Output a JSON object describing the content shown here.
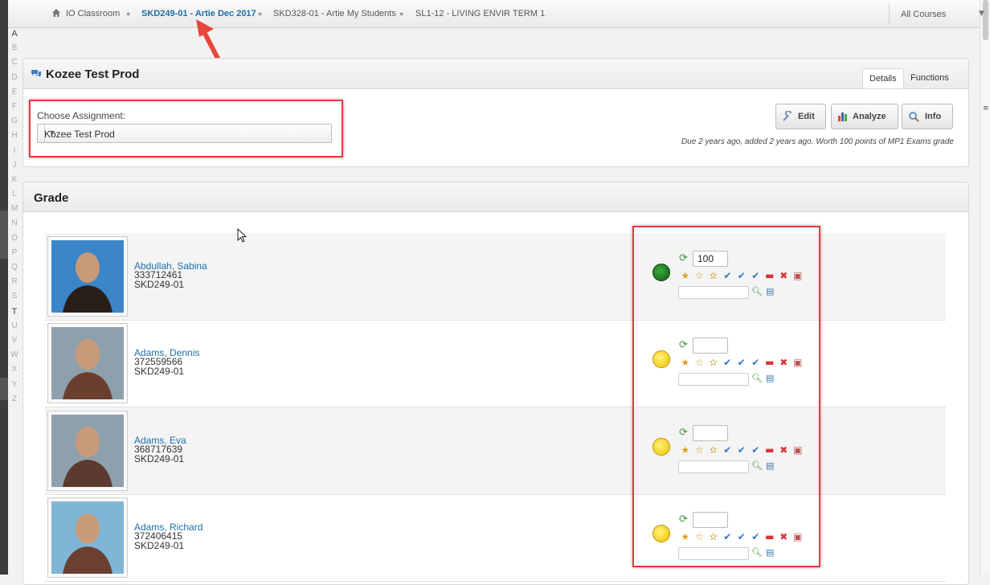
{
  "breadcrumb": {
    "items": [
      {
        "label": "IO Classroom",
        "active": false
      },
      {
        "label": "SKD249-01 - Artie Dec 2017",
        "active": true
      },
      {
        "label": "SKD328-01 - Artie My Students",
        "active": false
      },
      {
        "label": "SL1-12 - LIVING ENVIR TERM 1",
        "active": false
      }
    ],
    "courses_label": "All Courses"
  },
  "alpha_index": [
    "A",
    "B",
    "C",
    "D",
    "E",
    "F",
    "G",
    "H",
    "I",
    "J",
    "K",
    "L",
    "M",
    "N",
    "O",
    "P",
    "Q",
    "R",
    "S",
    "T",
    "U",
    "V",
    "W",
    "X",
    "Y",
    "Z"
  ],
  "assignment_panel": {
    "title": "Kozee Test Prod",
    "tabs": [
      {
        "label": "Details",
        "selected": true
      },
      {
        "label": "Functions",
        "selected": false
      }
    ],
    "choose_label": "Choose Assignment:",
    "selected_assignment": "Kozee Test Prod",
    "buttons": {
      "edit": "Edit",
      "analyze": "Analyze",
      "info": "Info"
    },
    "due_text": "Due 2 years ago, added 2 years ago. Worth 100 points of MP1 Exams grade"
  },
  "grade_panel": {
    "title": "Grade",
    "students": [
      {
        "name": "Abdullah, Sabina",
        "id": "333712461",
        "class": "SKD249-01",
        "score": "100",
        "status": "green"
      },
      {
        "name": "Adams, Dennis",
        "id": "372559566",
        "class": "SKD249-01",
        "score": "",
        "status": "yellow"
      },
      {
        "name": "Adams, Eva",
        "id": "368717639",
        "class": "SKD249-01",
        "score": "",
        "status": "yellow"
      },
      {
        "name": "Adams, Richard",
        "id": "372406415",
        "class": "SKD249-01",
        "score": "",
        "status": "yellow"
      }
    ]
  },
  "colors": {
    "accent": "#1a6fa8",
    "highlight": "#e03b3b",
    "status_green": "#1e7a1e",
    "status_yellow": "#f5cd10"
  },
  "icons": [
    "home-icon",
    "chat-icon",
    "wrench-icon",
    "chart-icon",
    "magnifier-icon",
    "refresh-icon",
    "star-add-icon",
    "star-icon",
    "star-half-icon",
    "check-pen-icon",
    "check-icon",
    "check-edit-icon",
    "minus-icon",
    "x-icon",
    "page-delete-icon",
    "search-comment-icon",
    "card-icon"
  ]
}
